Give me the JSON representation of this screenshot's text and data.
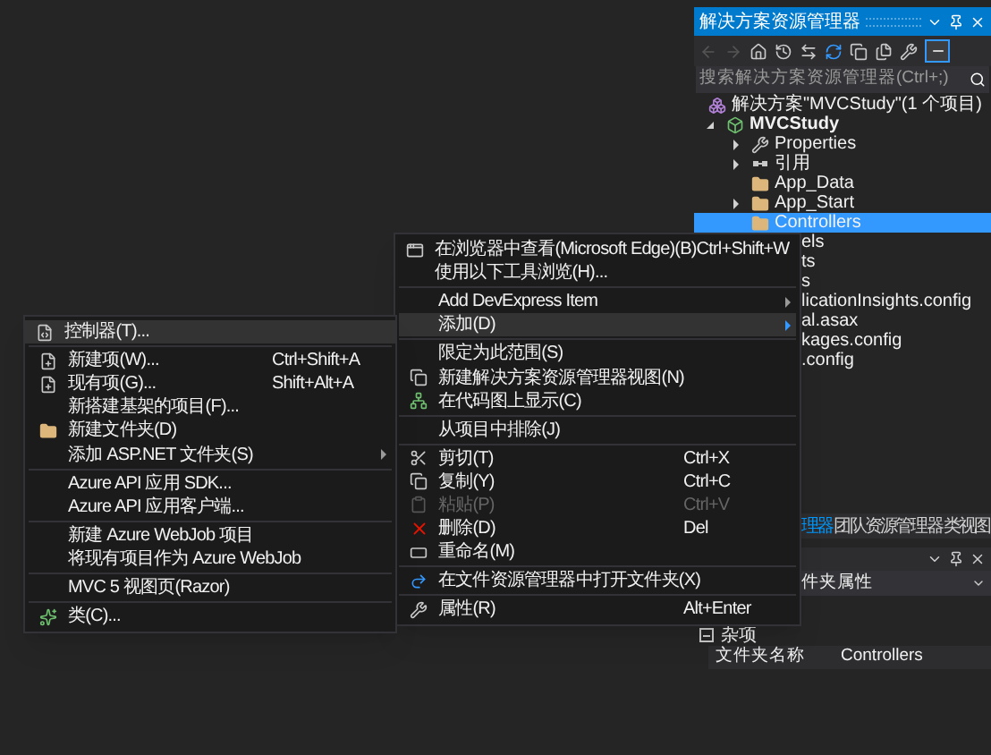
{
  "solution_explorer": {
    "title": "解决方案资源管理器",
    "search": {
      "placeholder": "搜索解决方案资源管理器(Ctrl+;)"
    },
    "tree": [
      {
        "label": "解决方案\"MVCStudy\"(1 个项目)",
        "kind": "solution",
        "selected": false,
        "children": [
          {
            "label": "MVCStudy",
            "kind": "project",
            "selected": false,
            "expanded": true,
            "children": [
              {
                "label": "Properties",
                "kind": "properties",
                "selected": false,
                "expanded": false
              },
              {
                "label": "引用",
                "kind": "references",
                "selected": false,
                "expanded": false
              },
              {
                "label": "App_Data",
                "kind": "folder",
                "selected": false
              },
              {
                "label": "App_Start",
                "kind": "folder",
                "selected": false,
                "expanded": false
              },
              {
                "label": "Controllers",
                "kind": "folder",
                "selected": true
              },
              {
                "label": "els",
                "selected": false
              },
              {
                "label": "ts",
                "selected": false
              },
              {
                "label": "s",
                "selected": false
              },
              {
                "label": "licationInsights.config",
                "selected": false
              },
              {
                "label": "al.asax",
                "selected": false
              },
              {
                "label": "kages.config",
                "selected": false
              },
              {
                "label": ".config",
                "selected": false
              }
            ]
          }
        ]
      }
    ]
  },
  "context_menu": {
    "groups": [
      [
        {
          "label": "在浏览器中查看(Microsoft Edge)(B)",
          "shortcut": "Ctrl+Shift+W",
          "selected": false,
          "disabled": false,
          "submenu": false
        },
        {
          "label": "使用以下工具浏览(H)...",
          "selected": false,
          "disabled": false,
          "submenu": false
        }
      ],
      [
        {
          "label": "Add DevExpress Item",
          "selected": false,
          "disabled": false,
          "submenu": true
        },
        {
          "label": "添加(D)",
          "selected": true,
          "disabled": false,
          "submenu": true
        }
      ],
      [
        {
          "label": "限定为此范围(S)",
          "selected": false,
          "disabled": false,
          "submenu": false
        },
        {
          "label": "新建解决方案资源管理器视图(N)",
          "selected": false,
          "disabled": false,
          "submenu": false
        },
        {
          "label": "在代码图上显示(C)",
          "selected": false,
          "disabled": false,
          "submenu": false
        }
      ],
      [
        {
          "label": "从项目中排除(J)",
          "selected": false,
          "disabled": false,
          "submenu": false
        }
      ],
      [
        {
          "label": "剪切(T)",
          "shortcut": "Ctrl+X",
          "selected": false,
          "disabled": false,
          "submenu": false
        },
        {
          "label": "复制(Y)",
          "shortcut": "Ctrl+C",
          "selected": false,
          "disabled": false,
          "submenu": false
        },
        {
          "label": "粘贴(P)",
          "shortcut": "Ctrl+V",
          "selected": false,
          "disabled": true,
          "submenu": false
        },
        {
          "label": "删除(D)",
          "shortcut": "Del",
          "selected": false,
          "disabled": false,
          "submenu": false
        },
        {
          "label": "重命名(M)",
          "selected": false,
          "disabled": false,
          "submenu": false
        }
      ],
      [
        {
          "label": "在文件资源管理器中打开文件夹(X)",
          "selected": false,
          "disabled": false,
          "submenu": false
        }
      ],
      [
        {
          "label": "属性(R)",
          "shortcut": "Alt+Enter",
          "selected": false,
          "disabled": false,
          "submenu": false
        }
      ]
    ]
  },
  "add_submenu": {
    "groups": [
      [
        {
          "label": "控制器(T)...",
          "selected": true,
          "disabled": false,
          "submenu": false
        }
      ],
      [
        {
          "label": "新建项(W)...",
          "shortcut": "Ctrl+Shift+A",
          "selected": false,
          "disabled": false,
          "submenu": false
        },
        {
          "label": "现有项(G)...",
          "shortcut": "Shift+Alt+A",
          "selected": false,
          "disabled": false,
          "submenu": false
        },
        {
          "label": "新搭建基架的项目(F)...",
          "selected": false,
          "disabled": false,
          "submenu": false
        },
        {
          "label": "新建文件夹(D)",
          "selected": false,
          "disabled": false,
          "submenu": false
        },
        {
          "label": "添加 ASP.NET 文件夹(S)",
          "selected": false,
          "disabled": false,
          "submenu": true
        }
      ],
      [
        {
          "label": "Azure API 应用 SDK...",
          "selected": false,
          "disabled": false,
          "submenu": false
        },
        {
          "label": "Azure API 应用客户端...",
          "selected": false,
          "disabled": false,
          "submenu": false
        }
      ],
      [
        {
          "label": "新建 Azure WebJob 项目",
          "selected": false,
          "disabled": false,
          "submenu": false
        },
        {
          "label": "将现有项目作为 Azure WebJob",
          "selected": false,
          "disabled": false,
          "submenu": false
        }
      ],
      [
        {
          "label": "MVC 5 视图页(Razor)",
          "selected": false,
          "disabled": false,
          "submenu": false
        }
      ],
      [
        {
          "label": "类(C)...",
          "selected": false,
          "disabled": false,
          "submenu": false
        }
      ]
    ]
  },
  "bottom_tabs": [
    {
      "label": "理器",
      "selected": true
    },
    {
      "label": "团队资源管理器",
      "selected": false
    },
    {
      "label": "类视图",
      "selected": false
    }
  ],
  "properties": {
    "object": "件夹属性",
    "category": {
      "label": "杂项",
      "expanded": true
    },
    "rows": [
      {
        "name": "文件夹名称",
        "value": "Controllers"
      }
    ]
  }
}
